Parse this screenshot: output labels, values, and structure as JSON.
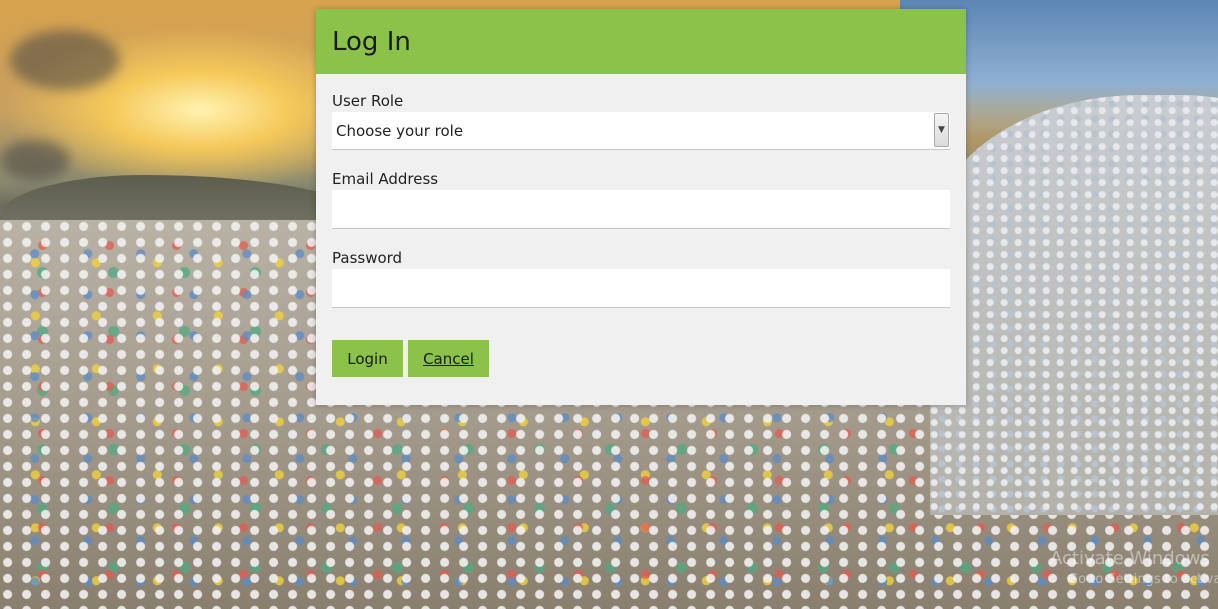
{
  "login_panel": {
    "title": "Log In",
    "role_label": "User Role",
    "role_selected": "Choose your role",
    "email_label": "Email Address",
    "email_value": "",
    "password_label": "Password",
    "password_value": "",
    "login_button": "Login",
    "cancel_button": "Cancel"
  },
  "overlay": {
    "watermark_line1": "Activate Windows",
    "watermark_line2": "Go to Settings to activate Windows."
  },
  "colors": {
    "accent": "#8bc34a",
    "panel_bg": "#f0f0f0"
  },
  "icons": {
    "select_arrow": "chevron-down-icon"
  }
}
